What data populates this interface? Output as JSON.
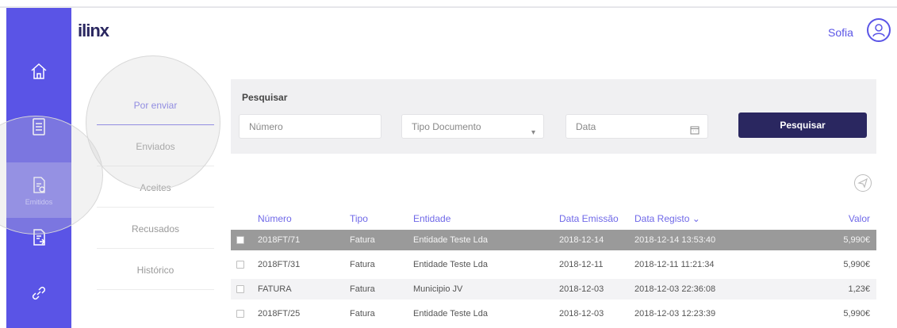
{
  "header": {
    "logo": "ilinx",
    "user_name": "Sofia"
  },
  "sidebar": {
    "items": [
      {
        "icon": "home-icon",
        "label": ""
      },
      {
        "icon": "document-icon",
        "label": ""
      },
      {
        "icon": "sent-document-icon",
        "label": "Emitidos"
      },
      {
        "icon": "received-document-icon",
        "label": ""
      },
      {
        "icon": "link-icon",
        "label": ""
      }
    ]
  },
  "submenu": {
    "items": [
      "Por enviar",
      "Enviados",
      "Aceites",
      "Recusados",
      "Histórico"
    ],
    "active": "Por enviar"
  },
  "search": {
    "title": "Pesquisar",
    "numero_placeholder": "Número",
    "tipo_value": "Tipo Documento",
    "data_placeholder": "Data",
    "button_label": "Pesquisar"
  },
  "table": {
    "columns": [
      "Número",
      "Tipo",
      "Entidade",
      "Data Emissão",
      "Data Registo",
      "Valor"
    ],
    "sort_indicator": "Data Registo",
    "rows": [
      {
        "numero": "2018FT/71",
        "tipo": "Fatura",
        "entidade": "Entidade Teste Lda",
        "data_emissao": "2018-12-14",
        "data_registo": "2018-12-14 13:53:40",
        "valor": "5,990€"
      },
      {
        "numero": "2018FT/31",
        "tipo": "Fatura",
        "entidade": "Entidade Teste Lda",
        "data_emissao": "2018-12-11",
        "data_registo": "2018-12-11 11:21:34",
        "valor": "5,990€"
      },
      {
        "numero": "FATURA",
        "tipo": "Fatura",
        "entidade": "Municipio JV",
        "data_emissao": "2018-12-03",
        "data_registo": "2018-12-03 22:36:08",
        "valor": "1,23€"
      },
      {
        "numero": "2018FT/25",
        "tipo": "Fatura",
        "entidade": "Entidade Teste Lda",
        "data_emissao": "2018-12-03",
        "data_registo": "2018-12-03 12:23:39",
        "valor": "5,990€"
      }
    ]
  },
  "colors": {
    "sidebar": "#5a54e6",
    "accent": "#6f68e8",
    "button": "#2a2760",
    "selected_row": "#9a9a9a"
  }
}
